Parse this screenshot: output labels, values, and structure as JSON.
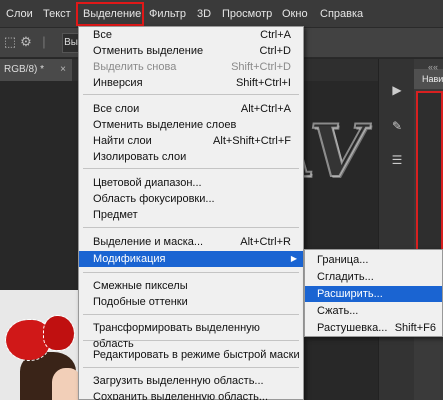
{
  "menubar": {
    "items": [
      "Слои",
      "Текст",
      "Выделение",
      "Фильтр",
      "3D",
      "Просмотр",
      "Окно",
      "Справка"
    ],
    "highlight_color": "#e01818"
  },
  "options_bar": {
    "button_label": "Вы"
  },
  "document_tab": {
    "label": "RGB/8) *",
    "close": "×"
  },
  "watermark": {
    "text": "D-NAV"
  },
  "right_panel": {
    "header": "Нави",
    "collapse": "««"
  },
  "select_menu": {
    "items": [
      {
        "label": "Все",
        "shortcut": "Ctrl+A",
        "disabled": false
      },
      {
        "label": "Отменить выделение",
        "shortcut": "Ctrl+D",
        "disabled": false
      },
      {
        "label": "Выделить снова",
        "shortcut": "Shift+Ctrl+D",
        "disabled": true
      },
      {
        "label": "Инверсия",
        "shortcut": "Shift+Ctrl+I",
        "disabled": false
      },
      {
        "label": "Все слои",
        "shortcut": "Alt+Ctrl+A",
        "disabled": false
      },
      {
        "label": "Отменить выделение слоев",
        "shortcut": "",
        "disabled": false
      },
      {
        "label": "Найти слои",
        "shortcut": "Alt+Shift+Ctrl+F",
        "disabled": false
      },
      {
        "label": "Изолировать слои",
        "shortcut": "",
        "disabled": false
      },
      {
        "label": "Цветовой диапазон...",
        "shortcut": "",
        "disabled": false
      },
      {
        "label": "Область фокусировки...",
        "shortcut": "",
        "disabled": false
      },
      {
        "label": "Предмет",
        "shortcut": "",
        "disabled": false
      },
      {
        "label": "Выделение и маска...",
        "shortcut": "Alt+Ctrl+R",
        "disabled": false
      },
      {
        "label": "Модификация",
        "shortcut": "",
        "disabled": false,
        "selected": true,
        "submenu_arrow": "▶"
      },
      {
        "label": "Смежные пикселы",
        "shortcut": "",
        "disabled": false
      },
      {
        "label": "Подобные оттенки",
        "shortcut": "",
        "disabled": false
      },
      {
        "label": "Трансформировать выделенную область",
        "shortcut": "",
        "disabled": false
      },
      {
        "label": "Редактировать в режиме быстрой маски",
        "shortcut": "",
        "disabled": false
      },
      {
        "label": "Загрузить выделенную область...",
        "shortcut": "",
        "disabled": false
      },
      {
        "label": "Сохранить выделенную область...",
        "shortcut": "",
        "disabled": false
      }
    ]
  },
  "modify_submenu": {
    "items": [
      {
        "label": "Граница...",
        "shortcut": ""
      },
      {
        "label": "Сгладить...",
        "shortcut": ""
      },
      {
        "label": "Расширить...",
        "shortcut": "",
        "selected": true
      },
      {
        "label": "Сжать...",
        "shortcut": ""
      },
      {
        "label": "Растушевка...",
        "shortcut": "Shift+F6"
      }
    ]
  },
  "colors": {
    "menu_highlight": "#1a64d2",
    "menubar_bg": "#3a3a3a",
    "menu_bg": "#f0f0f0"
  }
}
